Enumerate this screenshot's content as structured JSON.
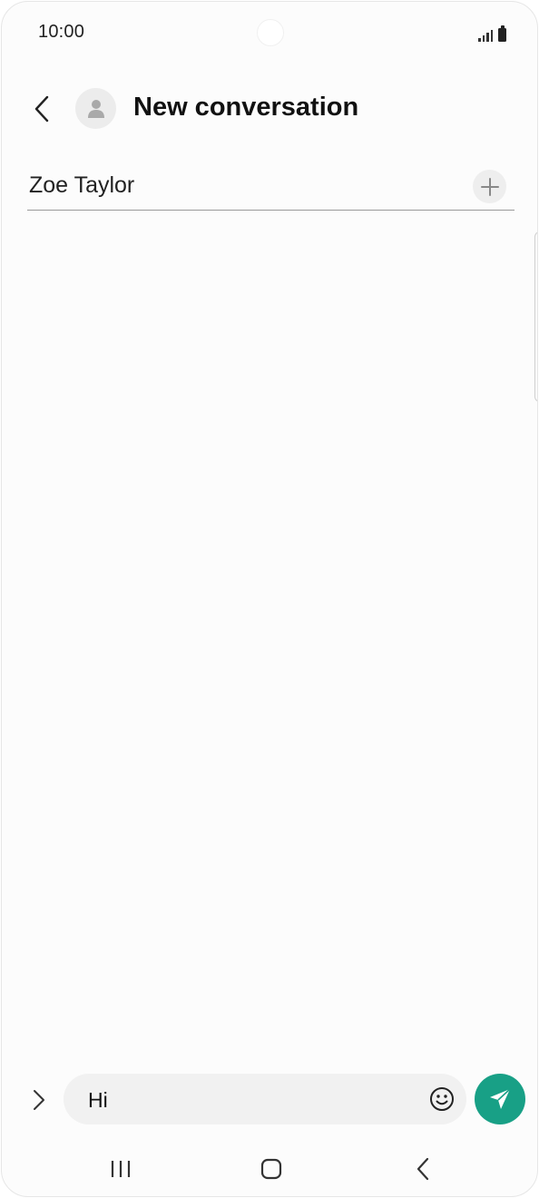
{
  "status_bar": {
    "time": "10:00",
    "icons": [
      "signal-icon",
      "battery-icon"
    ]
  },
  "header": {
    "back_icon": "chevron-left-icon",
    "avatar_icon": "person-icon",
    "title": "New conversation"
  },
  "recipient": {
    "value": "Zoe Taylor",
    "add_icon": "plus-icon"
  },
  "composer": {
    "expand_icon": "chevron-right-icon",
    "message_value": "Hi",
    "emoji_icon": "smiley-icon",
    "send_icon": "send-icon"
  },
  "navigation": {
    "items": [
      "recents-icon",
      "home-icon",
      "back-icon"
    ]
  },
  "colors": {
    "send_button": "#18a086",
    "background": "#fcfcfc",
    "input_background": "#f1f1f1"
  }
}
